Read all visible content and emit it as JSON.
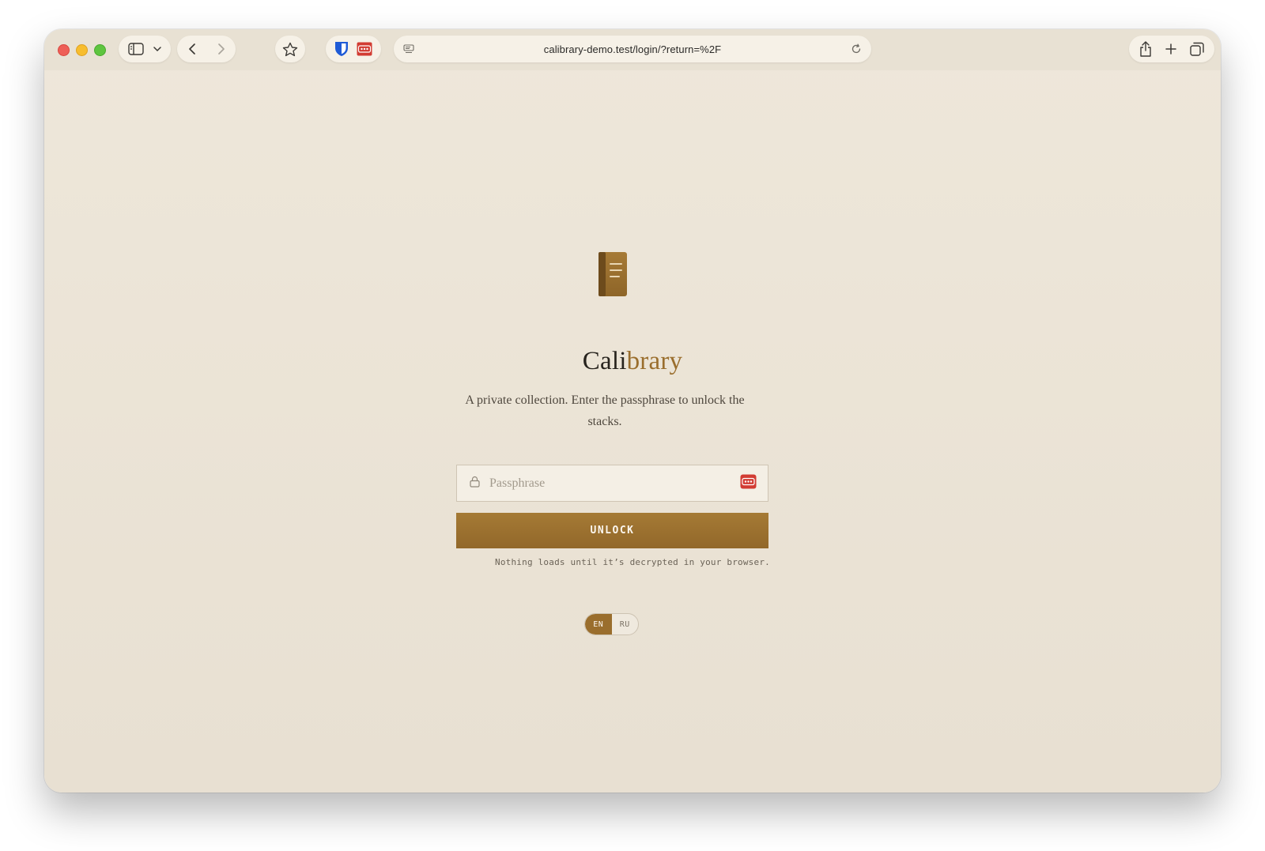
{
  "browser": {
    "url": "calibrary-demo.test/login/?return=%2F",
    "icons": {
      "sidebar": "sidebar-icon",
      "dropdown": "chevron-down-icon",
      "back": "chevron-left-icon",
      "forward": "chevron-right-icon",
      "bookmark": "star-icon",
      "bitwarden": "bitwarden-shield-icon",
      "password_manager": "password-dots-icon",
      "reader": "reader-icon",
      "reload": "reload-icon",
      "share": "share-icon",
      "new_tab": "plus-icon",
      "tabs": "tab-overview-icon"
    }
  },
  "login": {
    "brand_part1": "Cali",
    "brand_part2": "brary",
    "tagline": "A private collection. Enter the passphrase to unlock the stacks.",
    "passphrase_placeholder": "Passphrase",
    "passphrase_value": "",
    "unlock_label": "UNLOCK",
    "note": "Nothing loads until it’s decrypted in your browser.",
    "languages": [
      "EN",
      "RU"
    ],
    "active_language": "EN"
  },
  "colors": {
    "accent": "#9a6e2d",
    "background": "#ece5d8",
    "text": "#27231d"
  }
}
